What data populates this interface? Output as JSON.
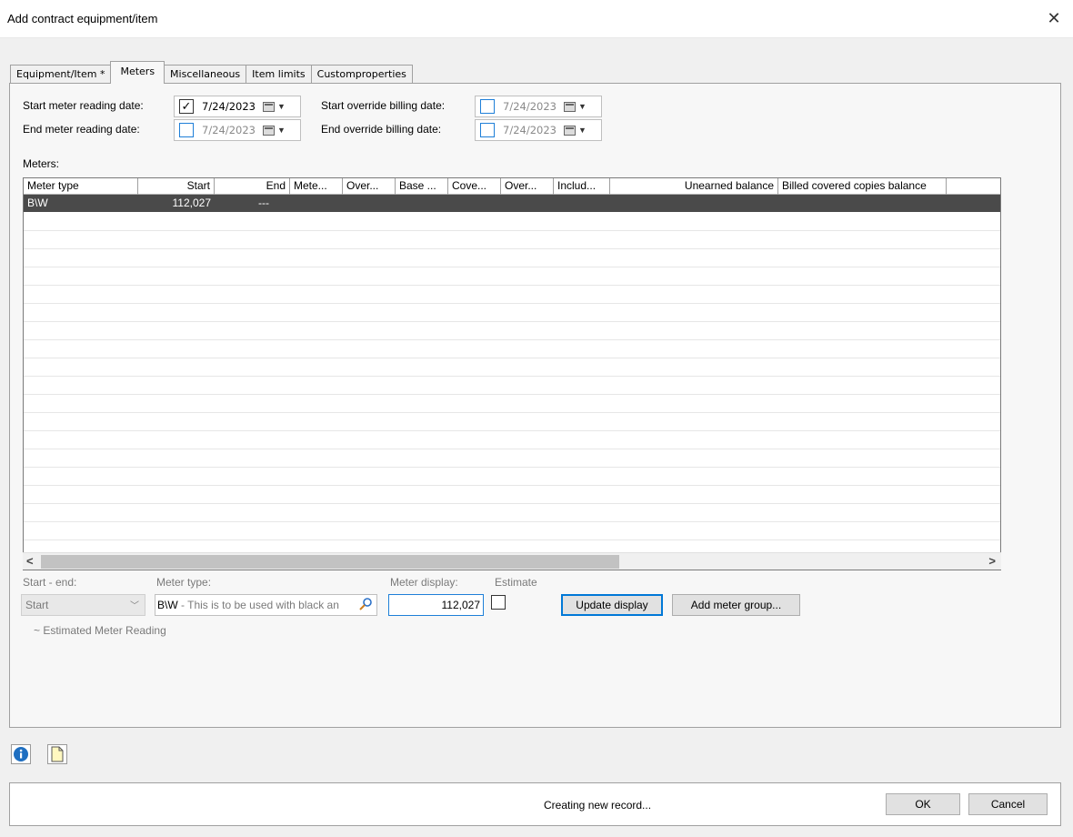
{
  "window": {
    "title": "Add contract equipment/item"
  },
  "tabs": [
    {
      "label": "Equipment/Item *"
    },
    {
      "label": "Meters"
    },
    {
      "label": "Miscellaneous"
    },
    {
      "label": "Item limits"
    },
    {
      "label": "Customproperties"
    }
  ],
  "dates": {
    "start_meter_label": "Start meter reading date:",
    "start_meter_value": "7/24/2023",
    "start_meter_checked": true,
    "end_meter_label": "End meter reading date:",
    "end_meter_value": "7/24/2023",
    "start_override_label": "Start override billing date:",
    "start_override_value": "7/24/2023",
    "end_override_label": "End override billing date:",
    "end_override_value": "7/24/2023"
  },
  "meters": {
    "label": "Meters:",
    "columns": [
      "Meter type",
      "Start",
      "End",
      "Mete...",
      "Over...",
      "Base ...",
      "Cove...",
      "Over...",
      "Includ...",
      "Unearned balance",
      "Billed covered copies balance"
    ],
    "rows": [
      {
        "meter_type": "B\\W",
        "start": "112,027",
        "end": "---"
      }
    ]
  },
  "form": {
    "start_end_label": "Start - end:",
    "start_end_value": "Start",
    "meter_type_label": "Meter type:",
    "meter_type_value_bold": "B\\W",
    "meter_type_value_rest": " - This is to be used with black an",
    "meter_display_label": "Meter display:",
    "meter_display_value": "112,027",
    "estimate_label": "Estimate",
    "update_display": "Update display",
    "add_meter_group": "Add meter group...",
    "estimated_note": "~ Estimated Meter Reading"
  },
  "footer": {
    "status": "Creating new record...",
    "ok": "OK",
    "cancel": "Cancel"
  },
  "colors": {
    "selection": "#4a4a4a",
    "accent": "#0078d7"
  }
}
